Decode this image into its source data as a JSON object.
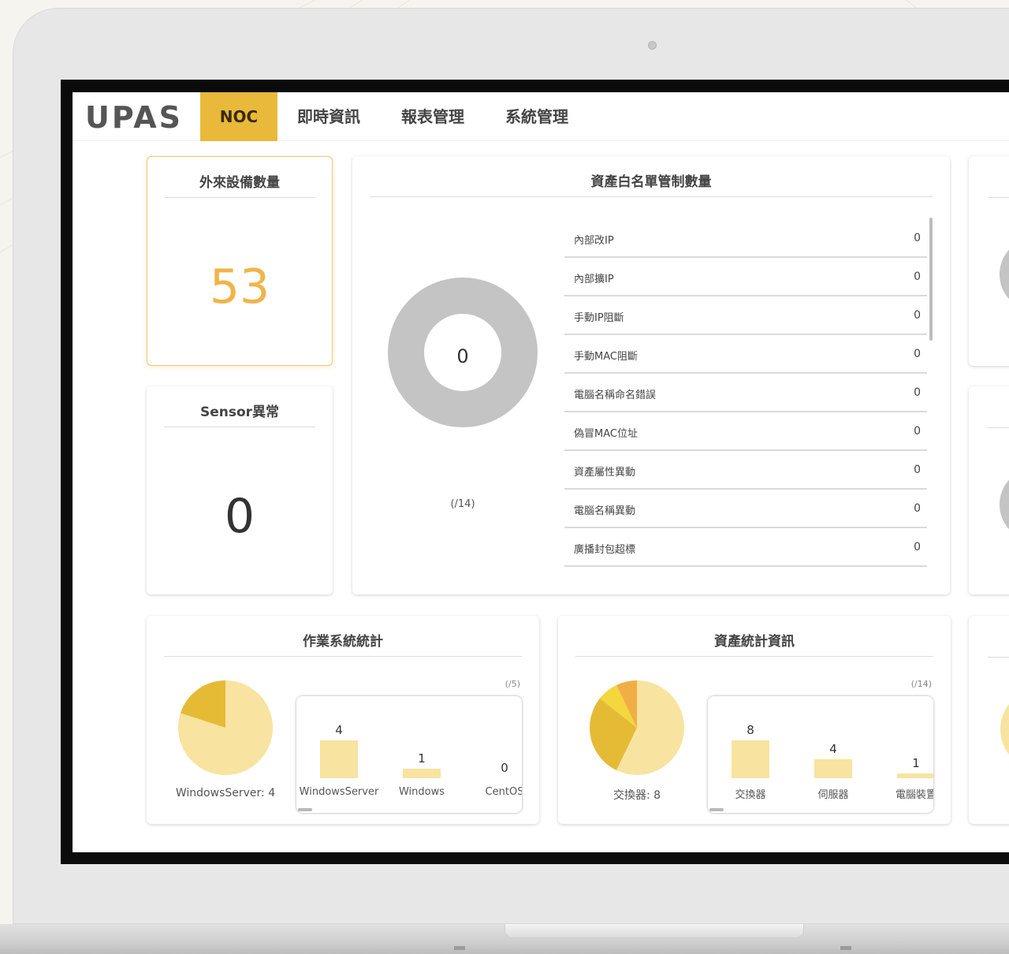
{
  "nav": {
    "logo": "UPAS",
    "tabs": [
      {
        "label": "NOC",
        "active": true
      },
      {
        "label": "即時資訊",
        "active": false
      },
      {
        "label": "報表管理",
        "active": false
      },
      {
        "label": "系統管理",
        "active": false
      }
    ]
  },
  "colors": {
    "accent": "#e8b93a",
    "highlight_number": "#f0b44a",
    "donut_gray": "#c4c4c4",
    "pie_light": "#f8e3a0",
    "pie_dark": "#e5bb36"
  },
  "cards": {
    "external_devices": {
      "title": "外來設備數量",
      "value": "53"
    },
    "sensor": {
      "title": "Sensor異常",
      "value": "0"
    },
    "whitelist": {
      "title": "資產白名單管制數量",
      "donut_value": "0",
      "donut_caption": "(/14)",
      "rows": [
        {
          "label": "內部改IP",
          "value": "0"
        },
        {
          "label": "內部擴IP",
          "value": "0"
        },
        {
          "label": "手動IP阻斷",
          "value": "0"
        },
        {
          "label": "手動MAC阻斷",
          "value": "0"
        },
        {
          "label": "電腦名稱命名錯誤",
          "value": "0"
        },
        {
          "label": "偽冒MAC位址",
          "value": "0"
        },
        {
          "label": "資產屬性異動",
          "value": "0"
        },
        {
          "label": "電腦名稱異動",
          "value": "0"
        },
        {
          "label": "廣播封包超標",
          "value": "0"
        }
      ]
    },
    "os_stats": {
      "title": "作業系統統計",
      "pie_label": "WindowsServer: 4",
      "total_caption": "(/5)",
      "chart_data": {
        "type": "bar",
        "categories": [
          "WindowsServer",
          "Windows",
          "CentOS"
        ],
        "values": [
          4,
          1,
          0
        ],
        "pie_values": [
          4,
          1
        ]
      }
    },
    "asset_stats": {
      "title": "資產統計資訊",
      "pie_label": "交換器: 8",
      "total_caption": "(/14)",
      "chart_data": {
        "type": "bar",
        "categories": [
          "交換器",
          "伺服器",
          "電腦裝置"
        ],
        "values": [
          8,
          4,
          1
        ]
      }
    }
  }
}
